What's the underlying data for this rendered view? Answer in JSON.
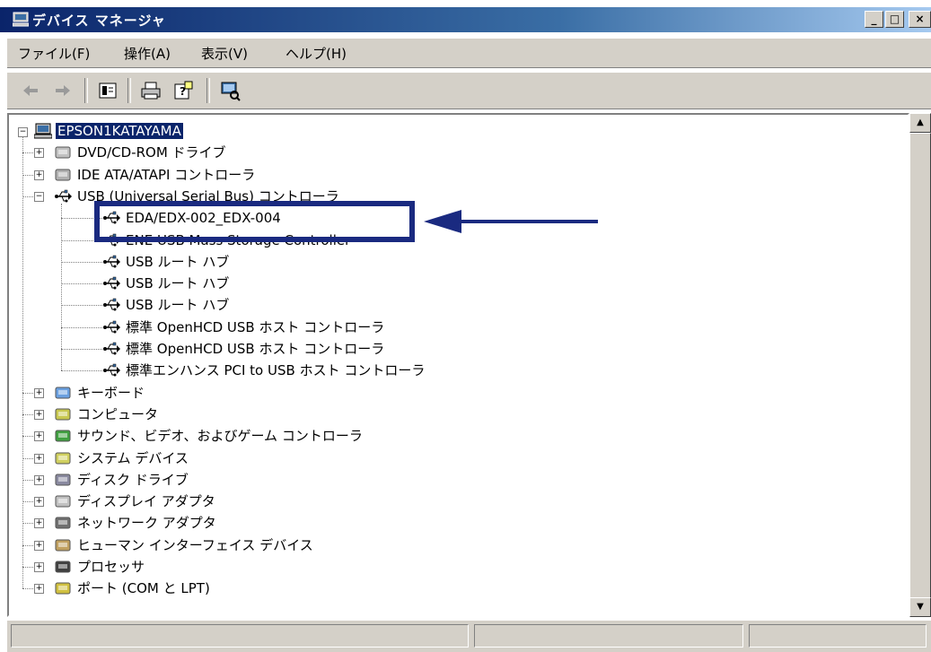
{
  "window": {
    "title": "デバイス マネージャ",
    "min_label": "_",
    "max_label": "□",
    "close_label": "×"
  },
  "menu": [
    "ファイル(F)",
    "操作(A)",
    "表示(V)",
    "ヘルプ(H)"
  ],
  "toolbar_icons": [
    "back-arrow-icon",
    "forward-arrow-icon",
    "properties-icon",
    "print-icon",
    "help-icon",
    "scan-hardware-icon"
  ],
  "tree": {
    "root": "EPSON1KATAYAMA",
    "categories": [
      {
        "label": "DVD/CD-ROM ドライブ",
        "expander": "+",
        "icon": "dvd-drive-icon"
      },
      {
        "label": "IDE ATA/ATAPI コントローラ",
        "expander": "+",
        "icon": "ide-controller-icon"
      },
      {
        "label": "USB (Universal Serial Bus) コントローラ",
        "expander": "−",
        "icon": "usb-icon",
        "children": [
          "EDA/EDX-002_EDX-004",
          "ENE USB Mass Storage Controller",
          "USB ルート ハブ",
          "USB ルート ハブ",
          "USB ルート ハブ",
          "標準 OpenHCD USB ホスト コントローラ",
          "標準 OpenHCD USB ホスト コントローラ",
          "標準エンハンス PCI to USB ホスト コントローラ"
        ]
      },
      {
        "label": "キーボード",
        "expander": "+",
        "icon": "keyboard-icon"
      },
      {
        "label": "コンピュータ",
        "expander": "+",
        "icon": "computer-icon"
      },
      {
        "label": "サウンド、ビデオ、およびゲーム コントローラ",
        "expander": "+",
        "icon": "sound-icon"
      },
      {
        "label": "システム デバイス",
        "expander": "+",
        "icon": "system-device-icon"
      },
      {
        "label": "ディスク ドライブ",
        "expander": "+",
        "icon": "disk-drive-icon"
      },
      {
        "label": "ディスプレイ アダプタ",
        "expander": "+",
        "icon": "display-adapter-icon"
      },
      {
        "label": "ネットワーク アダプタ",
        "expander": "+",
        "icon": "network-adapter-icon"
      },
      {
        "label": "ヒューマン インターフェイス デバイス",
        "expander": "+",
        "icon": "hid-icon"
      },
      {
        "label": "プロセッサ",
        "expander": "+",
        "icon": "processor-icon"
      },
      {
        "label": "ポート (COM と LPT)",
        "expander": "+",
        "icon": "port-icon"
      }
    ]
  },
  "colors": {
    "titlebar": "#0a246a",
    "selection": "#0a246a",
    "annotation": "#1a2a80",
    "chrome": "#d4d0c8"
  }
}
